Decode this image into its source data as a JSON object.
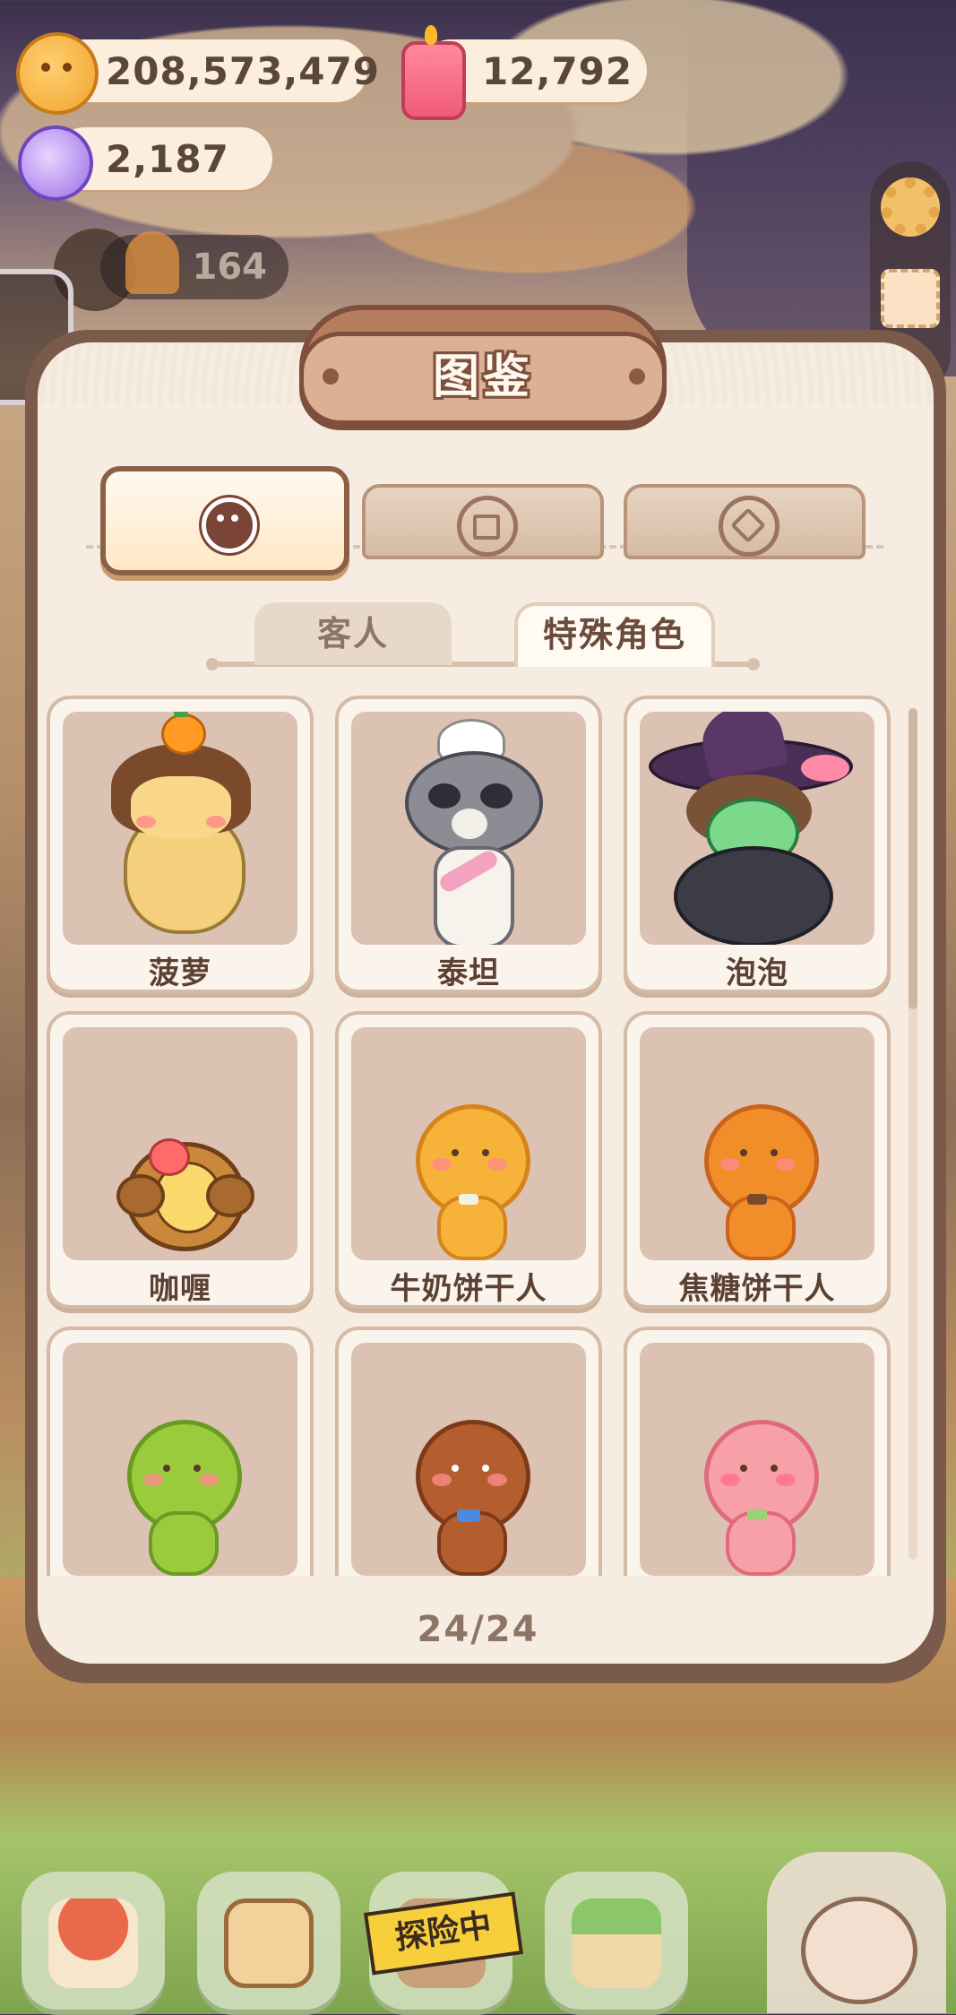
{
  "currency": {
    "coins": "208,573,479",
    "candles": "12,792",
    "candy": "2,187",
    "dimmed_counter": "164"
  },
  "modal": {
    "title": "图鉴",
    "main_tabs": [
      {
        "icon": "character-face-icon",
        "active": true
      },
      {
        "icon": "gift-box-icon",
        "active": false
      },
      {
        "icon": "coin-badge-icon",
        "active": false
      }
    ],
    "sub_tabs": [
      {
        "label": "客人",
        "active": false
      },
      {
        "label": "特殊角色",
        "active": true
      }
    ],
    "cards": [
      {
        "name": "菠萝",
        "art": "pineapple-cat"
      },
      {
        "name": "泰坦",
        "art": "raccoon-chef"
      },
      {
        "name": "泡泡",
        "art": "witch-cauldron"
      },
      {
        "name": "咖喱",
        "art": "curry-cookie"
      },
      {
        "name": "牛奶饼干人",
        "art": "milk-cookie-man"
      },
      {
        "name": "焦糖饼干人",
        "art": "caramel-cookie-man"
      },
      {
        "name": "",
        "art": "green-cookie-man"
      },
      {
        "name": "",
        "art": "brown-cookie-man"
      },
      {
        "name": "",
        "art": "pink-cookie-man"
      }
    ],
    "counter": "24/24"
  },
  "bottom_nav": {
    "adventure_label": "探险中"
  },
  "colors": {
    "panel": "#f6ece1",
    "frame": "#7a5a4a",
    "card_art_bg": "#dcc2b3",
    "text_dark": "#5c4034",
    "text_muted": "#8d7566"
  }
}
